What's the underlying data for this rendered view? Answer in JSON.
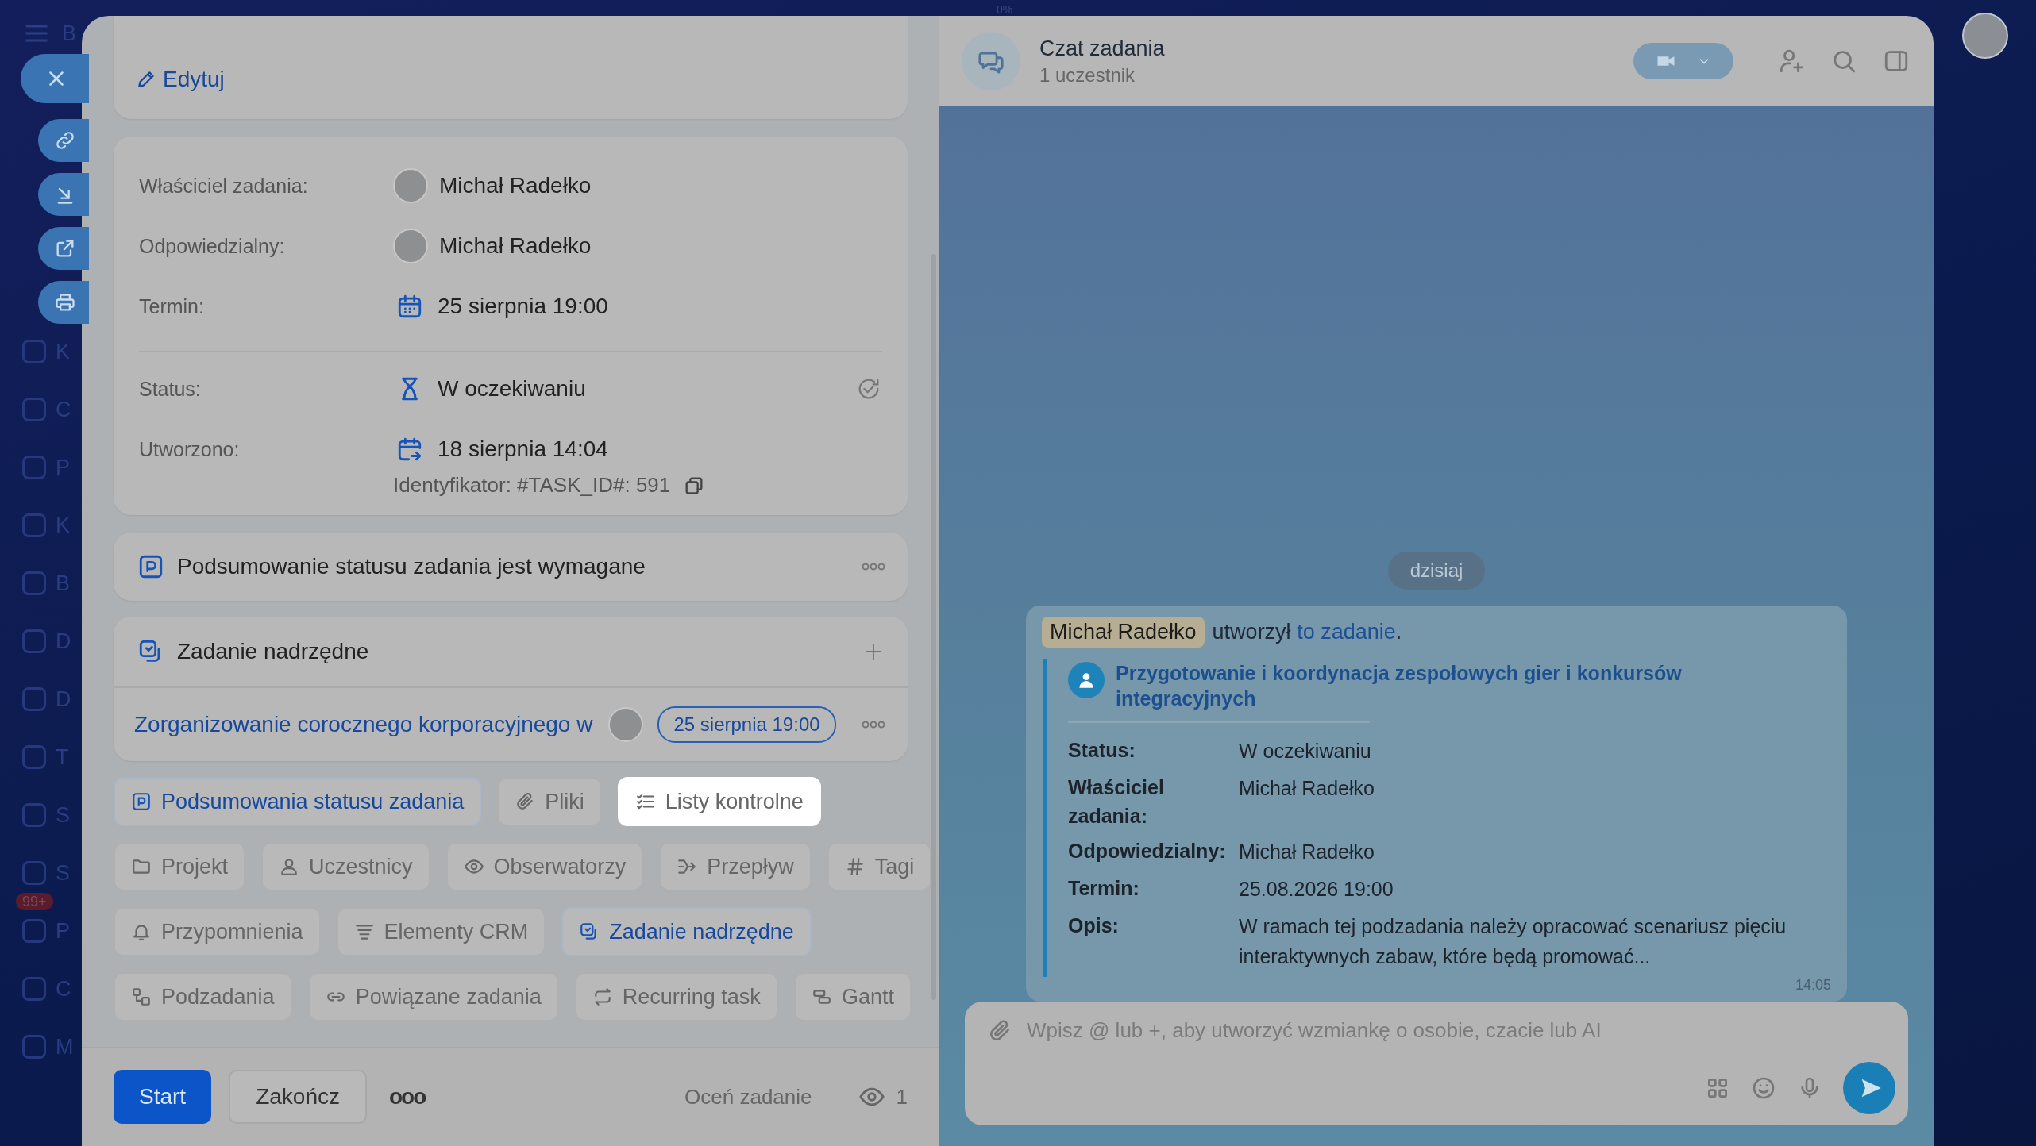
{
  "top_progress": "0%",
  "sidebar": {
    "items": [
      {
        "initial": "B"
      },
      {
        "initial": "K"
      },
      {
        "initial": "C"
      },
      {
        "initial": "P"
      },
      {
        "initial": "K"
      },
      {
        "initial": "B"
      },
      {
        "initial": "D"
      },
      {
        "initial": "D"
      },
      {
        "initial": "T"
      },
      {
        "initial": "S"
      },
      {
        "initial": "S"
      },
      {
        "initial": "P",
        "badge": "99+"
      },
      {
        "initial": "C"
      },
      {
        "initial": "M"
      }
    ]
  },
  "task": {
    "edit_label": "Edytuj",
    "fields": [
      {
        "kind": "person",
        "label": "Właściciel zadania:",
        "value": "Michał Radełko"
      },
      {
        "kind": "person",
        "label": "Odpowiedzialny:",
        "value": "Michał Radełko"
      },
      {
        "kind": "date",
        "label": "Termin:",
        "value": "25 sierpnia 19:00"
      },
      {
        "kind": "status",
        "label": "Status:",
        "value": "W oczekiwaniu"
      },
      {
        "kind": "created",
        "label": "Utworzono:",
        "value": "18 sierpnia 14:04"
      }
    ],
    "identifier": "Identyfikator: #TASK_ID#: 591",
    "summary_required": "Podsumowanie statusu zadania jest wymagane",
    "parent": {
      "heading": "Zadanie nadrzędne",
      "title": "Zorganizowanie corocznego korporacyjnego w",
      "date": "25 sierpnia 19:00"
    },
    "chips": [
      [
        {
          "kind": "summary",
          "label": "Podsumowania statusu zadania",
          "active": true,
          "highlighted": false
        },
        {
          "kind": "clip",
          "label": "Pliki",
          "active": false,
          "highlighted": false
        },
        {
          "kind": "checklist",
          "label": "Listy kontrolne",
          "active": false,
          "highlighted": true
        }
      ],
      [
        {
          "kind": "folder",
          "label": "Projekt",
          "active": false,
          "highlighted": false
        },
        {
          "kind": "person",
          "label": "Uczestnicy",
          "active": false,
          "highlighted": false
        },
        {
          "kind": "eye",
          "label": "Obserwatorzy",
          "active": false,
          "highlighted": false
        },
        {
          "kind": "flow",
          "label": "Przepływ",
          "active": false,
          "highlighted": false
        },
        {
          "kind": "hash",
          "label": "Tagi",
          "active": false,
          "highlighted": false
        }
      ],
      [
        {
          "kind": "bell",
          "label": "Przypomnienia",
          "active": false,
          "highlighted": false
        },
        {
          "kind": "crm",
          "label": "Elementy CRM",
          "active": false,
          "highlighted": false
        },
        {
          "kind": "parent",
          "label": "Zadanie nadrzędne",
          "active": true,
          "highlighted": false
        }
      ],
      [
        {
          "kind": "subtasks",
          "label": "Podzadania",
          "active": false,
          "highlighted": false
        },
        {
          "kind": "link",
          "label": "Powiązane zadania",
          "active": false,
          "highlighted": false
        },
        {
          "kind": "repeat",
          "label": "Recurring task",
          "active": false,
          "highlighted": false
        },
        {
          "kind": "gantt",
          "label": "Gantt",
          "active": false,
          "highlighted": false
        }
      ]
    ],
    "footer": {
      "start": "Start",
      "finish": "Zakończ",
      "more": "ooo",
      "rate": "Oceń zadanie",
      "views": "1"
    }
  },
  "chat": {
    "title": "Czat zadania",
    "subtitle": "1 uczestnik",
    "date_divider": "dzisiaj",
    "message": {
      "author": "Michał Radełko",
      "verb": "utworzył",
      "link": "to zadanie",
      "end": ".",
      "card_title": "Przygotowanie i koordynacja zespołowych gier i konkursów integracyjnych",
      "fields": [
        {
          "label": "Status:",
          "value": "W oczekiwaniu"
        },
        {
          "label": "Właściciel zadania:",
          "value": "Michał Radełko"
        },
        {
          "label": "Odpowiedzialny:",
          "value": "Michał Radełko"
        },
        {
          "label": "Termin:",
          "value": "25.08.2026 19:00"
        },
        {
          "label": "Opis:",
          "value": "W ramach tej podzadania należy opracować scenariusz pięciu interaktywnych zabaw, które będą promować..."
        }
      ],
      "time": "14:05"
    },
    "input": {
      "placeholder": "Wpisz @ lub +, aby utworzyć wzmiankę o osobie, czacie lub AI"
    }
  }
}
